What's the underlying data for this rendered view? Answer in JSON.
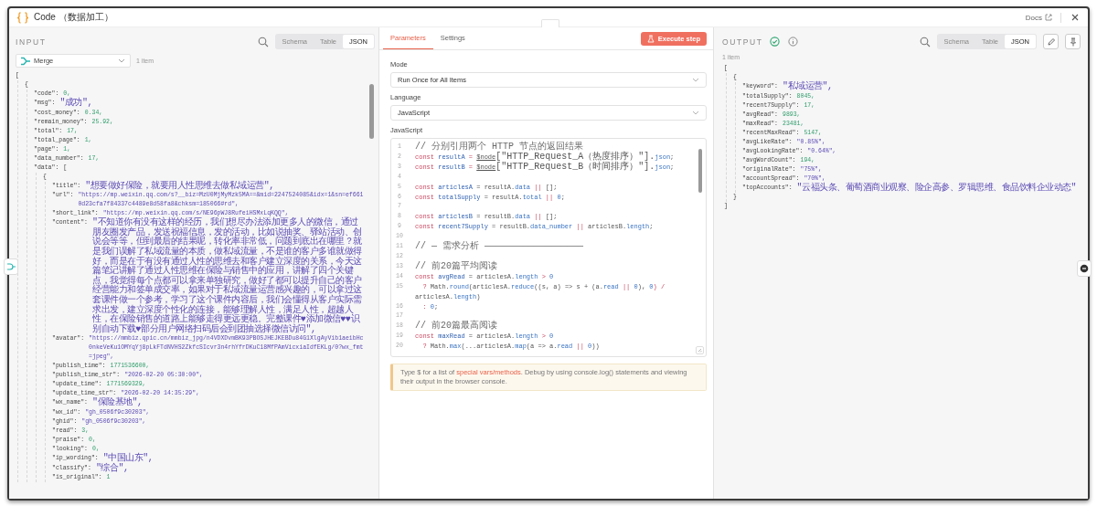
{
  "window": {
    "title": "Code （数据加工）",
    "docs_link": "Docs"
  },
  "input": {
    "title": "INPUT",
    "view_tabs": [
      {
        "label": "Schema",
        "selected": false
      },
      {
        "label": "Table",
        "selected": false
      },
      {
        "label": "JSON",
        "selected": true
      }
    ],
    "source": "Merge",
    "item_count": "1 item",
    "json": [
      {
        "open": "[",
        "children": [
          {
            "open": "{",
            "children": [
              {
                "key": "\"code\":",
                "value": "0,",
                "kind": "number"
              },
              {
                "key": "\"msg\":",
                "value": "\"成功\",",
                "kind": "string"
              },
              {
                "key": "\"cost_money\":",
                "value": "0.34,",
                "kind": "number"
              },
              {
                "key": "\"remain_money\":",
                "value": "25.92,",
                "kind": "number"
              },
              {
                "key": "\"total\":",
                "value": "17,",
                "kind": "number"
              },
              {
                "key": "\"total_page\":",
                "value": "1,",
                "kind": "number"
              },
              {
                "key": "\"page\":",
                "value": "1,",
                "kind": "number"
              },
              {
                "key": "\"data_number\":",
                "value": "17,",
                "kind": "number"
              },
              {
                "key": "\"data\":",
                "open": "[",
                "children": [
                  {
                    "open": "{",
                    "children": [
                      {
                        "key": "\"title\":",
                        "value": "\"想要做好保险，就要用人性思维去做私域运营\",",
                        "kind": "string"
                      },
                      {
                        "key": "\"url\":",
                        "value": "\"https://mp.weixin.qq.com/s?__biz=MzU0MjMyMzk5MA==&mid=2247524085&idx=1&sn=ef6610d23cfa7f84337c4489e8d58fa8&chksm=185066#rd\",",
                        "kind": "string"
                      },
                      {
                        "key": "\"short_link\":",
                        "value": "\"https://mp.weixin.qq.com/s/NE96pWJ8RufeiHSMxLqKQQ\",",
                        "kind": "string"
                      },
                      {
                        "key": "\"content\":",
                        "value": "\"不知道你有没有这样的经历，我们想尽办法添加更多人的微信，通过朋友圈发产品，发送祝福信息，发的活动，比如说抽奖、驿站活动、创说会等等，但到最后的结果呢，转化率非常低，问题到底出在哪里？就是我们误解了私域流量的本质，做私域流量，不是谁的客户多谁就做得好，而是在于有没有通过人性的思维去和客户建立深度的关系，今天这篇笔记讲解了通过人性思维在保险与销售中的应用，讲解了四个关键点，我觉得每个点都可以拿来单独研究，做好了都可以提升自己的客户经营能力和签单成交率，如果对于私域流量运营感兴趣的，可以拿过这套课件做一个参考，学习了这个课件内容后，我们会懂得从客户实际需求出发，建立深度个性化的连接，能够理解人性，满足人性，超越人性，在保险销售的道路上能够走得更远更稳。完整课件♥添加微信♥♥识别自动下载♥部分用户网络扫码后会到团抽选择微信访问\",",
                        "kind": "string"
                      },
                      {
                        "key": "\"avatar\":",
                        "value": "\"https://mmbiz.qpic.cn/mmbiz_jpg/n4VDXDvmBK93PBOSJHEJKEBDu84G1XlgAyVib1aeibHc0nkeVeKu1OMYqYj8pLkFTdNVHS2ZkfcSIcvr3n4rhYfrDKuC18MfPAmVicxiaIdfEKLg/0?wx_fmt=jpeg\",",
                        "kind": "string"
                      },
                      {
                        "key": "\"publish_time\":",
                        "value": "1771536600,",
                        "kind": "number"
                      },
                      {
                        "key": "\"publish_time_str\":",
                        "value": "\"2026-02-20 05:30:00\",",
                        "kind": "string"
                      },
                      {
                        "key": "\"update_time\":",
                        "value": "1771569329,",
                        "kind": "number"
                      },
                      {
                        "key": "\"update_time_str\":",
                        "value": "\"2026-02-20 14:35:29\",",
                        "kind": "string"
                      },
                      {
                        "key": "\"wx_name\":",
                        "value": "\"保险基地\",",
                        "kind": "string"
                      },
                      {
                        "key": "\"wx_id\":",
                        "value": "\"gh_0506f9c30203\",",
                        "kind": "string"
                      },
                      {
                        "key": "\"ghid\":",
                        "value": "\"gh_0506f9c30203\",",
                        "kind": "string"
                      },
                      {
                        "key": "\"read\":",
                        "value": "3,",
                        "kind": "number"
                      },
                      {
                        "key": "\"praise\":",
                        "value": "0,",
                        "kind": "number"
                      },
                      {
                        "key": "\"looking\":",
                        "value": "0,",
                        "kind": "number"
                      },
                      {
                        "key": "\"ip_wording\":",
                        "value": "\"中国山东\",",
                        "kind": "string"
                      },
                      {
                        "key": "\"classify\":",
                        "value": "\"综合\",",
                        "kind": "string"
                      },
                      {
                        "key": "\"is_original\":",
                        "value": "1",
                        "kind": "number"
                      }
                    ]
                  }
                ]
              }
            ]
          }
        ]
      }
    ]
  },
  "parameters": {
    "tabs": [
      {
        "label": "Parameters",
        "selected": true
      },
      {
        "label": "Settings",
        "selected": false
      }
    ],
    "execute_button": "Execute step",
    "fields": [
      {
        "label": "Mode",
        "value": "Run Once for All Items"
      },
      {
        "label": "Language",
        "value": "JavaScript"
      }
    ],
    "editor_label": "JavaScript",
    "code_lines": [
      {
        "number": "1",
        "tokens": [
          {
            "t": "// 分别引用两个 HTTP 节点的返回结果",
            "kind": "comment"
          }
        ]
      },
      {
        "number": "2",
        "tokens": [
          {
            "t": "const ",
            "kind": "kw"
          },
          {
            "t": "resultA",
            "kind": "def"
          },
          {
            "t": " = ",
            "kind": "op"
          },
          {
            "t": "$node",
            "kind": "node"
          },
          {
            "t": "[\"HTTP_Request_A（热度排序）\"].",
            "kind": "plain"
          },
          {
            "t": "json",
            "kind": "prop"
          },
          {
            "t": ";",
            "kind": "plain"
          }
        ]
      },
      {
        "number": "3",
        "tokens": [
          {
            "t": "const ",
            "kind": "kw"
          },
          {
            "t": "resultB",
            "kind": "def"
          },
          {
            "t": " = ",
            "kind": "op"
          },
          {
            "t": "$node",
            "kind": "node"
          },
          {
            "t": "[\"HTTP_Request_B（时间排序）\"].",
            "kind": "plain"
          },
          {
            "t": "json",
            "kind": "prop"
          },
          {
            "t": ";",
            "kind": "plain"
          }
        ]
      },
      {
        "number": "4"
      },
      {
        "number": "5",
        "tokens": [
          {
            "t": "const ",
            "kind": "kw"
          },
          {
            "t": "articlesA",
            "kind": "def"
          },
          {
            "t": " = resultA.",
            "kind": "plain"
          },
          {
            "t": "data",
            "kind": "prop"
          },
          {
            "t": " || ",
            "kind": "op"
          },
          {
            "t": "[];",
            "kind": "plain"
          }
        ]
      },
      {
        "number": "6",
        "tokens": [
          {
            "t": "const ",
            "kind": "kw"
          },
          {
            "t": "totalSupply",
            "kind": "def"
          },
          {
            "t": " = resultA.",
            "kind": "plain"
          },
          {
            "t": "total",
            "kind": "prop"
          },
          {
            "t": " || ",
            "kind": "op"
          },
          {
            "t": "0",
            "kind": "num"
          },
          {
            "t": ";",
            "kind": "plain"
          }
        ]
      },
      {
        "number": "7"
      },
      {
        "number": "8",
        "tokens": [
          {
            "t": "const ",
            "kind": "kw"
          },
          {
            "t": "articlesB",
            "kind": "def"
          },
          {
            "t": " = resultB.",
            "kind": "plain"
          },
          {
            "t": "data",
            "kind": "prop"
          },
          {
            "t": " || ",
            "kind": "op"
          },
          {
            "t": "[];",
            "kind": "plain"
          }
        ]
      },
      {
        "number": "9",
        "tokens": [
          {
            "t": "const ",
            "kind": "kw"
          },
          {
            "t": "recent7Supply",
            "kind": "def"
          },
          {
            "t": " = resultB.",
            "kind": "plain"
          },
          {
            "t": "data_number",
            "kind": "prop"
          },
          {
            "t": " || ",
            "kind": "op"
          },
          {
            "t": "articlesB.",
            "kind": "plain"
          },
          {
            "t": "length",
            "kind": "prop"
          },
          {
            "t": ";",
            "kind": "plain"
          }
        ]
      },
      {
        "number": "10"
      },
      {
        "number": "11",
        "tokens": [
          {
            "t": "// — 需求分析 ——————————————————",
            "kind": "comment"
          }
        ]
      },
      {
        "number": "12"
      },
      {
        "number": "13",
        "tokens": [
          {
            "t": "// 前20篇平均阅读",
            "kind": "comment"
          }
        ]
      },
      {
        "number": "14",
        "tokens": [
          {
            "t": "const ",
            "kind": "kw"
          },
          {
            "t": "avgRead",
            "kind": "def"
          },
          {
            "t": " = articlesA.",
            "kind": "plain"
          },
          {
            "t": "length",
            "kind": "prop"
          },
          {
            "t": " > ",
            "kind": "op"
          },
          {
            "t": "0",
            "kind": "num"
          }
        ]
      },
      {
        "number": "15",
        "tokens": [
          {
            "t": "  ? ",
            "kind": "op"
          },
          {
            "t": "Math.",
            "kind": "plain"
          },
          {
            "t": "round",
            "kind": "prop"
          },
          {
            "t": "(articlesA.",
            "kind": "plain"
          },
          {
            "t": "reduce",
            "kind": "prop"
          },
          {
            "t": "((s, a) => s + (a.",
            "kind": "plain"
          },
          {
            "t": "read",
            "kind": "prop"
          },
          {
            "t": " || ",
            "kind": "op"
          },
          {
            "t": "0",
            "kind": "num"
          },
          {
            "t": "), ",
            "kind": "plain"
          },
          {
            "t": "0",
            "kind": "num"
          },
          {
            "t": ") / ",
            "kind": "op"
          },
          {
            "t": "articlesA.",
            "kind": "plain"
          },
          {
            "t": "length",
            "kind": "prop"
          },
          {
            "t": ")",
            "kind": "plain"
          }
        ]
      },
      {
        "number": "16",
        "tokens": [
          {
            "t": "  : ",
            "kind": "op"
          },
          {
            "t": "0",
            "kind": "num"
          },
          {
            "t": ";",
            "kind": "plain"
          }
        ]
      },
      {
        "number": "17"
      },
      {
        "number": "18",
        "tokens": [
          {
            "t": "// 前20篇最高阅读",
            "kind": "comment"
          }
        ]
      },
      {
        "number": "19",
        "tokens": [
          {
            "t": "const ",
            "kind": "kw"
          },
          {
            "t": "maxRead",
            "kind": "def"
          },
          {
            "t": " = articlesA.",
            "kind": "plain"
          },
          {
            "t": "length",
            "kind": "prop"
          },
          {
            "t": " > ",
            "kind": "op"
          },
          {
            "t": "0",
            "kind": "num"
          }
        ]
      },
      {
        "number": "20",
        "tokens": [
          {
            "t": "  ? ",
            "kind": "op"
          },
          {
            "t": "Math.",
            "kind": "plain"
          },
          {
            "t": "max",
            "kind": "prop"
          },
          {
            "t": "(...articlesA.",
            "kind": "plain"
          },
          {
            "t": "map",
            "kind": "prop"
          },
          {
            "t": "(a => a.",
            "kind": "plain"
          },
          {
            "t": "read",
            "kind": "prop"
          },
          {
            "t": " || ",
            "kind": "op"
          },
          {
            "t": "0",
            "kind": "num"
          },
          {
            "t": "))",
            "kind": "plain"
          }
        ]
      }
    ],
    "hint": {
      "before": "Type $ for a list of ",
      "link": "special vars/methods",
      "after": ". Debug by using console.log() statements and viewing their output in the browser console."
    }
  },
  "output": {
    "title": "OUTPUT",
    "success": true,
    "view_tabs": [
      {
        "label": "Schema",
        "selected": false
      },
      {
        "label": "Table",
        "selected": false
      },
      {
        "label": "JSON",
        "selected": true
      }
    ],
    "item_count": "1 item",
    "json": [
      {
        "open": "[",
        "close": "]",
        "children": [
          {
            "open": "{",
            "close": "}",
            "children": [
              {
                "key": "\"keyword\":",
                "value": "\"私域运营\",",
                "kind": "string"
              },
              {
                "key": "\"totalSupply\":",
                "value": "8045,",
                "kind": "number"
              },
              {
                "key": "\"recent7Supply\":",
                "value": "17,",
                "kind": "number"
              },
              {
                "key": "\"avgRead\":",
                "value": "9893,",
                "kind": "number"
              },
              {
                "key": "\"maxRead\":",
                "value": "23481,",
                "kind": "number"
              },
              {
                "key": "\"recentMaxRead\":",
                "value": "5147,",
                "kind": "number"
              },
              {
                "key": "\"avgLikeRate\":",
                "value": "\"0.85%\",",
                "kind": "string"
              },
              {
                "key": "\"avgLookingRate\":",
                "value": "\"0.64%\",",
                "kind": "string"
              },
              {
                "key": "\"avgWordCount\":",
                "value": "194,",
                "kind": "number"
              },
              {
                "key": "\"originalRate\":",
                "value": "\"75%\",",
                "kind": "string"
              },
              {
                "key": "\"accountSpread\":",
                "value": "\"70%\",",
                "kind": "string"
              },
              {
                "key": "\"topAccounts\":",
                "value": "\"云福头条、葡萄酒商业观察、险企高参、罗辑思维、食品饮料企业动态\"",
                "kind": "string"
              }
            ]
          }
        ]
      }
    ]
  }
}
